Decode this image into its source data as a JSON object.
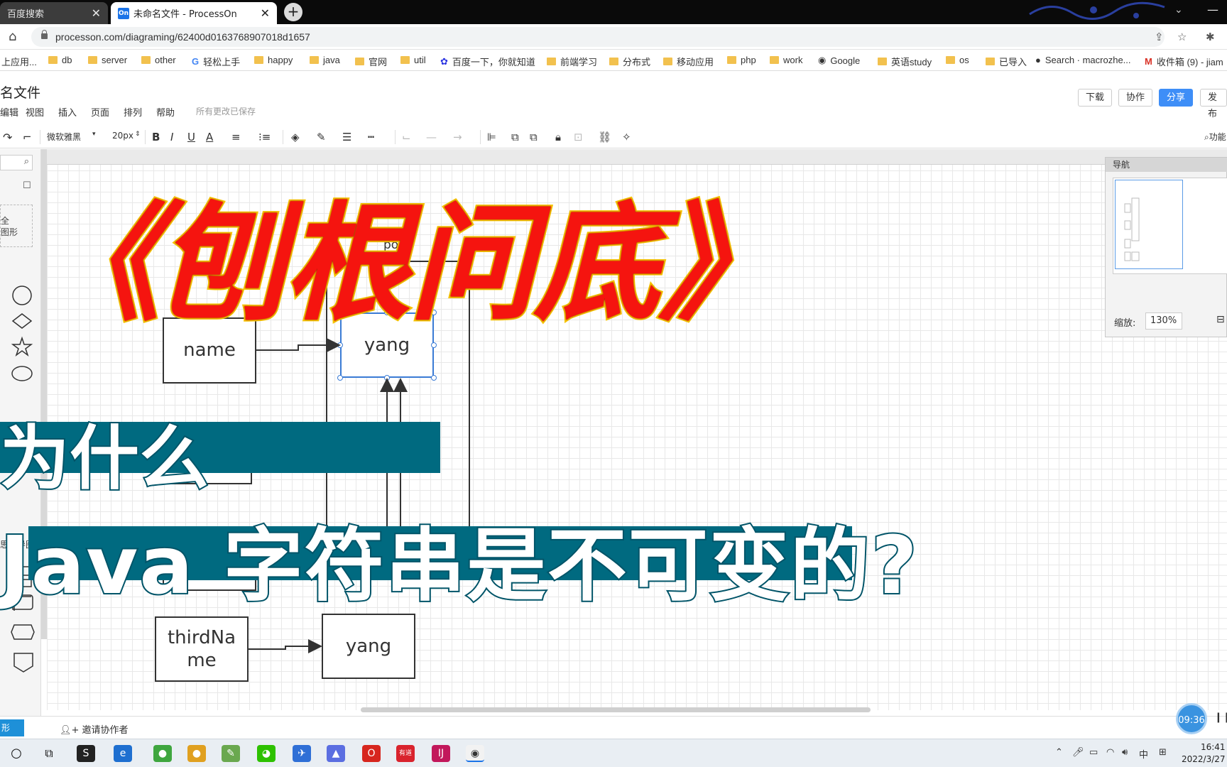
{
  "browser": {
    "tabs": [
      {
        "label": "百度搜索"
      },
      {
        "label": "未命名文件 - ProcessOn",
        "favicon": "On"
      }
    ],
    "url": "processon.com/diagraming/62400d0163768907018d1657",
    "bookmarks": [
      "上应用...",
      "db",
      "server",
      "other",
      "轻松上手",
      "happy",
      "java",
      "官网",
      "util",
      "百度一下，你就知道",
      "前端学习",
      "分布式",
      "移动应用",
      "php",
      "work",
      "Google",
      "英语study",
      "os",
      "已导入",
      "Search · macrozhe...",
      "收件箱 (9) - jiam"
    ]
  },
  "app": {
    "doc_title": "名文件",
    "menu": [
      "编辑",
      "视图",
      "插入",
      "页面",
      "排列",
      "帮助"
    ],
    "save_status": "所有更改已保存",
    "buttons": {
      "download": "下载",
      "collaborate": "协作",
      "share": "分享",
      "publish": "发布"
    },
    "toolbar": {
      "font": "微软雅黑",
      "size": "20px",
      "bold": "B",
      "italic": "I",
      "underline": "U",
      "font_color": "A"
    },
    "function_search": "功能"
  },
  "left_panel": {
    "shape_group_1": "全",
    "shape_group_2": "图形",
    "section_label": "思维导图",
    "bottom_button": "形"
  },
  "diagram": {
    "pool_label": "pool",
    "nodes": {
      "name": "name",
      "yang_top": "yang",
      "third_name": "thirdNa\nme",
      "yang_bottom": "yang"
    }
  },
  "navigator": {
    "title": "导航",
    "zoom_label": "缩放:",
    "zoom_value": "130%"
  },
  "overlay": {
    "title": "《刨根问底》",
    "subtitle_1": "为什么",
    "subtitle_2": "Java 字符串是不可变的?"
  },
  "status": {
    "invite": "邀请协作者",
    "timer": "09:36"
  },
  "taskbar": {
    "time": "16:41",
    "date": "2022/3/27",
    "ime": "中"
  }
}
